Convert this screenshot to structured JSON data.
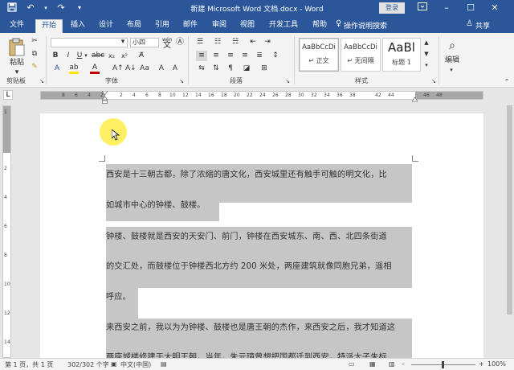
{
  "titlebar": {
    "title": "新建 Microsoft Word 文档.docx - Word",
    "login": "登录",
    "save_icon": "save-icon",
    "undo_icon": "undo-icon",
    "redo_icon": "redo-icon"
  },
  "tabs": [
    "文件",
    "开始",
    "插入",
    "设计",
    "布局",
    "引用",
    "邮件",
    "审阅",
    "视图",
    "开发工具",
    "帮助"
  ],
  "active_tab": "开始",
  "tell_me": "操作说明搜索",
  "share": "共享",
  "ribbon": {
    "clipboard": {
      "paste": "粘贴",
      "label": "剪贴板"
    },
    "font": {
      "font_name": "",
      "font_size": "小四",
      "label": "字体",
      "wen": "wén"
    },
    "paragraph": {
      "label": "段落"
    },
    "styles": {
      "label": "样式",
      "items": [
        {
          "sample": "AaBbCcDi",
          "name": "↵ 正文"
        },
        {
          "sample": "AaBbCcDi",
          "name": "↵ 无间隔"
        },
        {
          "sample": "AaBl",
          "name": "标题 1"
        }
      ]
    },
    "editing": {
      "label": "编辑"
    }
  },
  "ruler": {
    "ticks": [
      "8",
      "6",
      "4",
      "2",
      "",
      "2",
      "4",
      "6",
      "8",
      "10",
      "12",
      "14",
      "16",
      "18",
      "20",
      "22",
      "24",
      "26",
      "28",
      "30",
      "32",
      "34",
      "36",
      "38",
      "",
      "42",
      "44",
      "46",
      "48"
    ],
    "vticks": [
      "1",
      "2",
      "4",
      "6",
      "8",
      "10",
      "12",
      "14",
      "16"
    ]
  },
  "document": {
    "lines": [
      "西安是十三朝古都，除了浓缩的唐文化，西安城里还有触手可触的明文化，比",
      "如城市中心的钟楼、鼓楼。",
      "钟楼、鼓楼就是西安的天安门、前门，钟楼在西安城东、南、西、北四条街道",
      "的交汇处，而鼓楼位于钟楼西北方约 200 米处，两座建筑就像同胞兄弟，遥相",
      "呼应。",
      "来西安之前，我以为为钟楼、鼓楼也是唐王朝的杰作，来西安之后，我才知道这",
      "两座城楼修建于大明王朝，当年，朱元璋曾想把国都迁到西安，特派太子朱标"
    ]
  },
  "status": {
    "page": "第 1 页，共 1 页",
    "words": "302/302 个字",
    "language": "中文(中国)",
    "zoom": "100%"
  },
  "colors": {
    "accent": "#2b579a",
    "selection": "#c6c6c6"
  }
}
